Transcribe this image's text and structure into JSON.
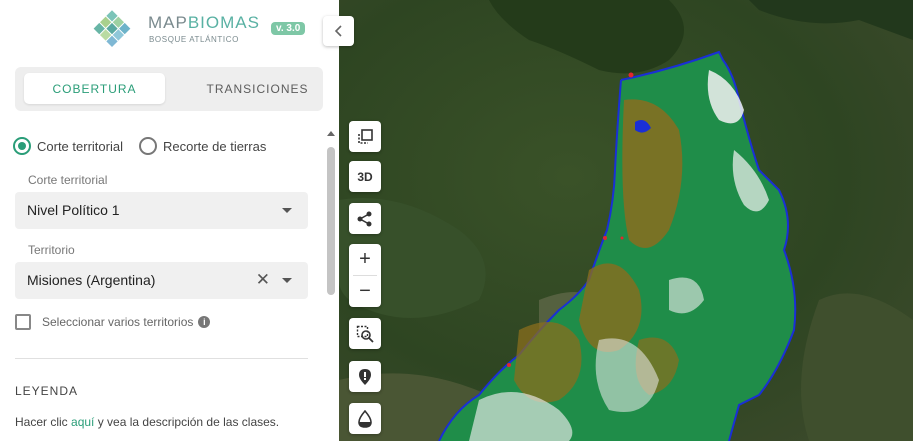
{
  "header": {
    "brand_map": "MAP",
    "brand_biomas": "BIOMAS",
    "brand_sub": "BOSQUE ATLÁNTICO",
    "version": "v. 3.0"
  },
  "tabs": [
    {
      "label": "COBERTURA",
      "active": true
    },
    {
      "label": "TRANSICIONES",
      "active": false
    }
  ],
  "mode_options": [
    {
      "label": "Corte territorial",
      "checked": true
    },
    {
      "label": "Recorte de tierras",
      "checked": false
    }
  ],
  "filters": {
    "corte_label": "Corte territorial",
    "corte_value": "Nivel Político 1",
    "territorio_label": "Territorio",
    "territorio_value": "Misiones (Argentina)",
    "multi_label": "Seleccionar varios territorios"
  },
  "legend": {
    "title": "LEYENDA",
    "text_before": "Hacer clic ",
    "link": "aquí",
    "text_after": " y vea la descripción de las clases."
  },
  "map_controls": [
    {
      "name": "layers-icon"
    },
    {
      "name": "3d-button",
      "label": "3D"
    },
    {
      "name": "share-icon"
    },
    {
      "name": "zoom-in-icon",
      "label": "+"
    },
    {
      "name": "zoom-out-icon",
      "label": "−"
    },
    {
      "name": "zoom-area-icon"
    },
    {
      "name": "location-pin-icon"
    },
    {
      "name": "opacity-drop-icon"
    }
  ],
  "colors": {
    "accent": "#2a9d78",
    "forest": "#1f8d49",
    "agriculture": "#8a6d1e",
    "boundary": "#1a2fd6"
  }
}
